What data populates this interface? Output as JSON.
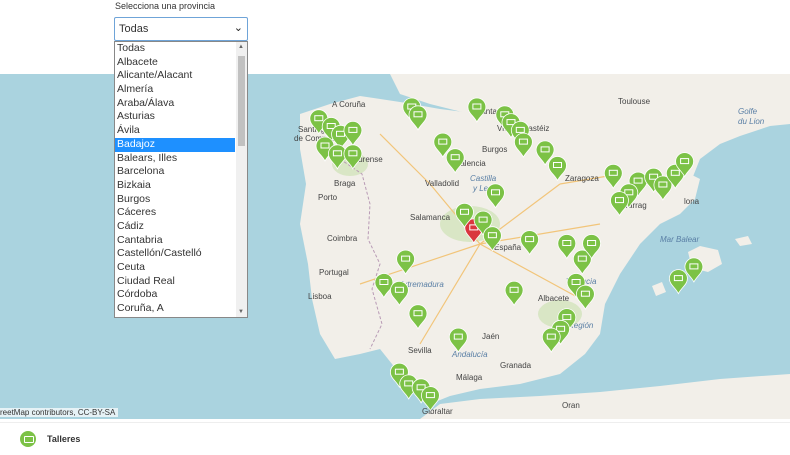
{
  "selector": {
    "label": "Selecciona una provincia",
    "current_value": "Todas",
    "options": [
      "Todas",
      "Albacete",
      "Alicante/Alacant",
      "Almería",
      "Araba/Álava",
      "Asturias",
      "Ávila",
      "Badajoz",
      "Balears, Illes",
      "Barcelona",
      "Bizkaia",
      "Burgos",
      "Cáceres",
      "Cádiz",
      "Cantabria",
      "Castellón/Castelló",
      "Ceuta",
      "Ciudad Real",
      "Córdoba",
      "Coruña, A"
    ],
    "highlighted": "Badajoz"
  },
  "map": {
    "attribution": "reetMap contributors, CC-BY-SA",
    "labels": {
      "toulouse": "Toulouse",
      "golfe": "Golfe",
      "du_lion": "du Lion",
      "a_coruna": "A Coruña",
      "santiago": "Santiago",
      "de_compost": "de Compost",
      "ourense": "Ourense",
      "santander": "Santander",
      "vitoria": "Vitoria-Gastéiz",
      "palencia": "Palencia",
      "burgos": "Burgos",
      "braga": "Braga",
      "valladolid": "Valladolid",
      "castilla": "Castilla",
      "y_leon": "y León",
      "zaragoza": "Zaragoza",
      "tarrag": "Tarrag",
      "lona": "lona",
      "porto": "Porto",
      "salamanca": "Salamanca",
      "coimbra": "Coimbra",
      "espana": "España",
      "mar_balear": "Mar Balear",
      "portugal": "Portugal",
      "lisboa": "Lisboa",
      "extremadura": "Extremadura",
      "albacete": "Albacete",
      "valencia": "Valencia",
      "sevilla": "Sevilla",
      "jaen": "Jaén",
      "andalucia": "Andalucía",
      "region": "Región",
      "malaga": "Málaga",
      "granada": "Granada",
      "gibraltar": "Gibraltar",
      "oran": "Oran"
    }
  },
  "legend": {
    "label": "Talleres"
  },
  "colors": {
    "marker": "#7cc246",
    "selected_marker": "#d9363e",
    "sea": "#aad3df",
    "land": "#f2efe9"
  },
  "markers": [
    {
      "name": "madrid-selected",
      "lon": -3.9,
      "lat": 40.3,
      "selected": true
    },
    {
      "name": "a",
      "lon": -8.9,
      "lat": 43.1
    },
    {
      "name": "b",
      "lon": -8.5,
      "lat": 42.9
    },
    {
      "name": "c",
      "lon": -8.2,
      "lat": 42.7
    },
    {
      "name": "d",
      "lon": -8.7,
      "lat": 42.4
    },
    {
      "name": "e",
      "lon": -8.3,
      "lat": 42.2
    },
    {
      "name": "f",
      "lon": -7.8,
      "lat": 42.8
    },
    {
      "name": "g",
      "lon": -5.9,
      "lat": 43.4
    },
    {
      "name": "h",
      "lon": -5.7,
      "lat": 43.2
    },
    {
      "name": "i",
      "lon": -3.8,
      "lat": 43.4
    },
    {
      "name": "j",
      "lon": -2.9,
      "lat": 43.2
    },
    {
      "name": "k",
      "lon": -2.7,
      "lat": 43.0
    },
    {
      "name": "l",
      "lon": -2.4,
      "lat": 42.8
    },
    {
      "name": "m",
      "lon": -2.3,
      "lat": 42.5
    },
    {
      "name": "n",
      "lon": -4.5,
      "lat": 42.1
    },
    {
      "name": "o",
      "lon": -1.6,
      "lat": 42.3
    },
    {
      "name": "p",
      "lon": -1.2,
      "lat": 41.9
    },
    {
      "name": "q",
      "lon": 0.6,
      "lat": 41.7
    },
    {
      "name": "r",
      "lon": 1.4,
      "lat": 41.5
    },
    {
      "name": "s",
      "lon": 1.9,
      "lat": 41.6
    },
    {
      "name": "t",
      "lon": 2.2,
      "lat": 41.4
    },
    {
      "name": "u",
      "lon": 2.6,
      "lat": 41.7
    },
    {
      "name": "v",
      "lon": 2.9,
      "lat": 42.0
    },
    {
      "name": "w",
      "lon": 1.1,
      "lat": 41.2
    },
    {
      "name": "x",
      "lon": 0.8,
      "lat": 41.0
    },
    {
      "name": "y",
      "lon": -3.2,
      "lat": 41.2
    },
    {
      "name": "z",
      "lon": -4.2,
      "lat": 40.7
    },
    {
      "name": "aa",
      "lon": -3.6,
      "lat": 40.5
    },
    {
      "name": "ab",
      "lon": -3.3,
      "lat": 40.1
    },
    {
      "name": "ac",
      "lon": -2.1,
      "lat": 40.0
    },
    {
      "name": "ad",
      "lon": -0.9,
      "lat": 39.9
    },
    {
      "name": "ae",
      "lon": -0.4,
      "lat": 39.5
    },
    {
      "name": "af",
      "lon": -0.1,
      "lat": 39.9
    },
    {
      "name": "ag",
      "lon": -0.6,
      "lat": 38.9
    },
    {
      "name": "ah",
      "lon": -0.3,
      "lat": 38.6
    },
    {
      "name": "ai",
      "lon": -0.9,
      "lat": 38.0
    },
    {
      "name": "aj",
      "lon": -1.1,
      "lat": 37.7
    },
    {
      "name": "ak",
      "lon": -1.4,
      "lat": 37.5
    },
    {
      "name": "al",
      "lon": -2.6,
      "lat": 38.7
    },
    {
      "name": "am",
      "lon": -6.1,
      "lat": 39.5
    },
    {
      "name": "an",
      "lon": -6.8,
      "lat": 38.9
    },
    {
      "name": "ao",
      "lon": -6.3,
      "lat": 38.7
    },
    {
      "name": "ap",
      "lon": -5.7,
      "lat": 38.1
    },
    {
      "name": "aq",
      "lon": -4.4,
      "lat": 37.5
    },
    {
      "name": "ar",
      "lon": -6.3,
      "lat": 36.6
    },
    {
      "name": "as",
      "lon": -6.0,
      "lat": 36.3
    },
    {
      "name": "at",
      "lon": -5.6,
      "lat": 36.2
    },
    {
      "name": "au",
      "lon": -5.3,
      "lat": 36.0
    },
    {
      "name": "av",
      "lon": 3.2,
      "lat": 39.3
    },
    {
      "name": "aw",
      "lon": 2.7,
      "lat": 39.0
    },
    {
      "name": "ax",
      "lon": -7.8,
      "lat": 42.2
    },
    {
      "name": "ay",
      "lon": -4.9,
      "lat": 42.5
    }
  ]
}
